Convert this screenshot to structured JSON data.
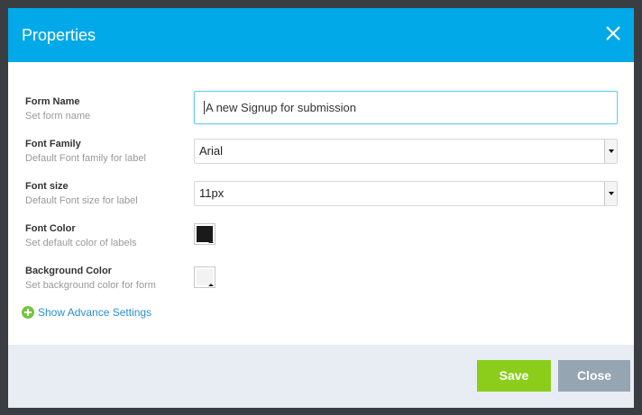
{
  "dialog": {
    "title": "Properties",
    "close_icon": "close-icon"
  },
  "fields": {
    "form_name": {
      "label": "Form Name",
      "hint": "Set form name",
      "value": "A new Signup for submission"
    },
    "font_family": {
      "label": "Font Family",
      "hint": "Default Font family for label",
      "value": "Arial"
    },
    "font_size": {
      "label": "Font size",
      "hint": "Default Font size for label",
      "value": "11px"
    },
    "font_color": {
      "label": "Font Color",
      "hint": "Set default color of labels",
      "color": "#1a1a1a"
    },
    "background_color": {
      "label": "Background Color",
      "hint": "Set background color for form",
      "color": "#f2f2f2"
    }
  },
  "advance_link": {
    "icon": "plus-circle-icon",
    "label": "Show Advance Settings"
  },
  "footer": {
    "save_label": "Save",
    "close_label": "Close"
  },
  "colors": {
    "header": "#01a9e9",
    "save": "#8ccd1b",
    "close": "#95a5b2",
    "link": "#2a8fd0",
    "footer_bg": "#e8ecf3"
  }
}
